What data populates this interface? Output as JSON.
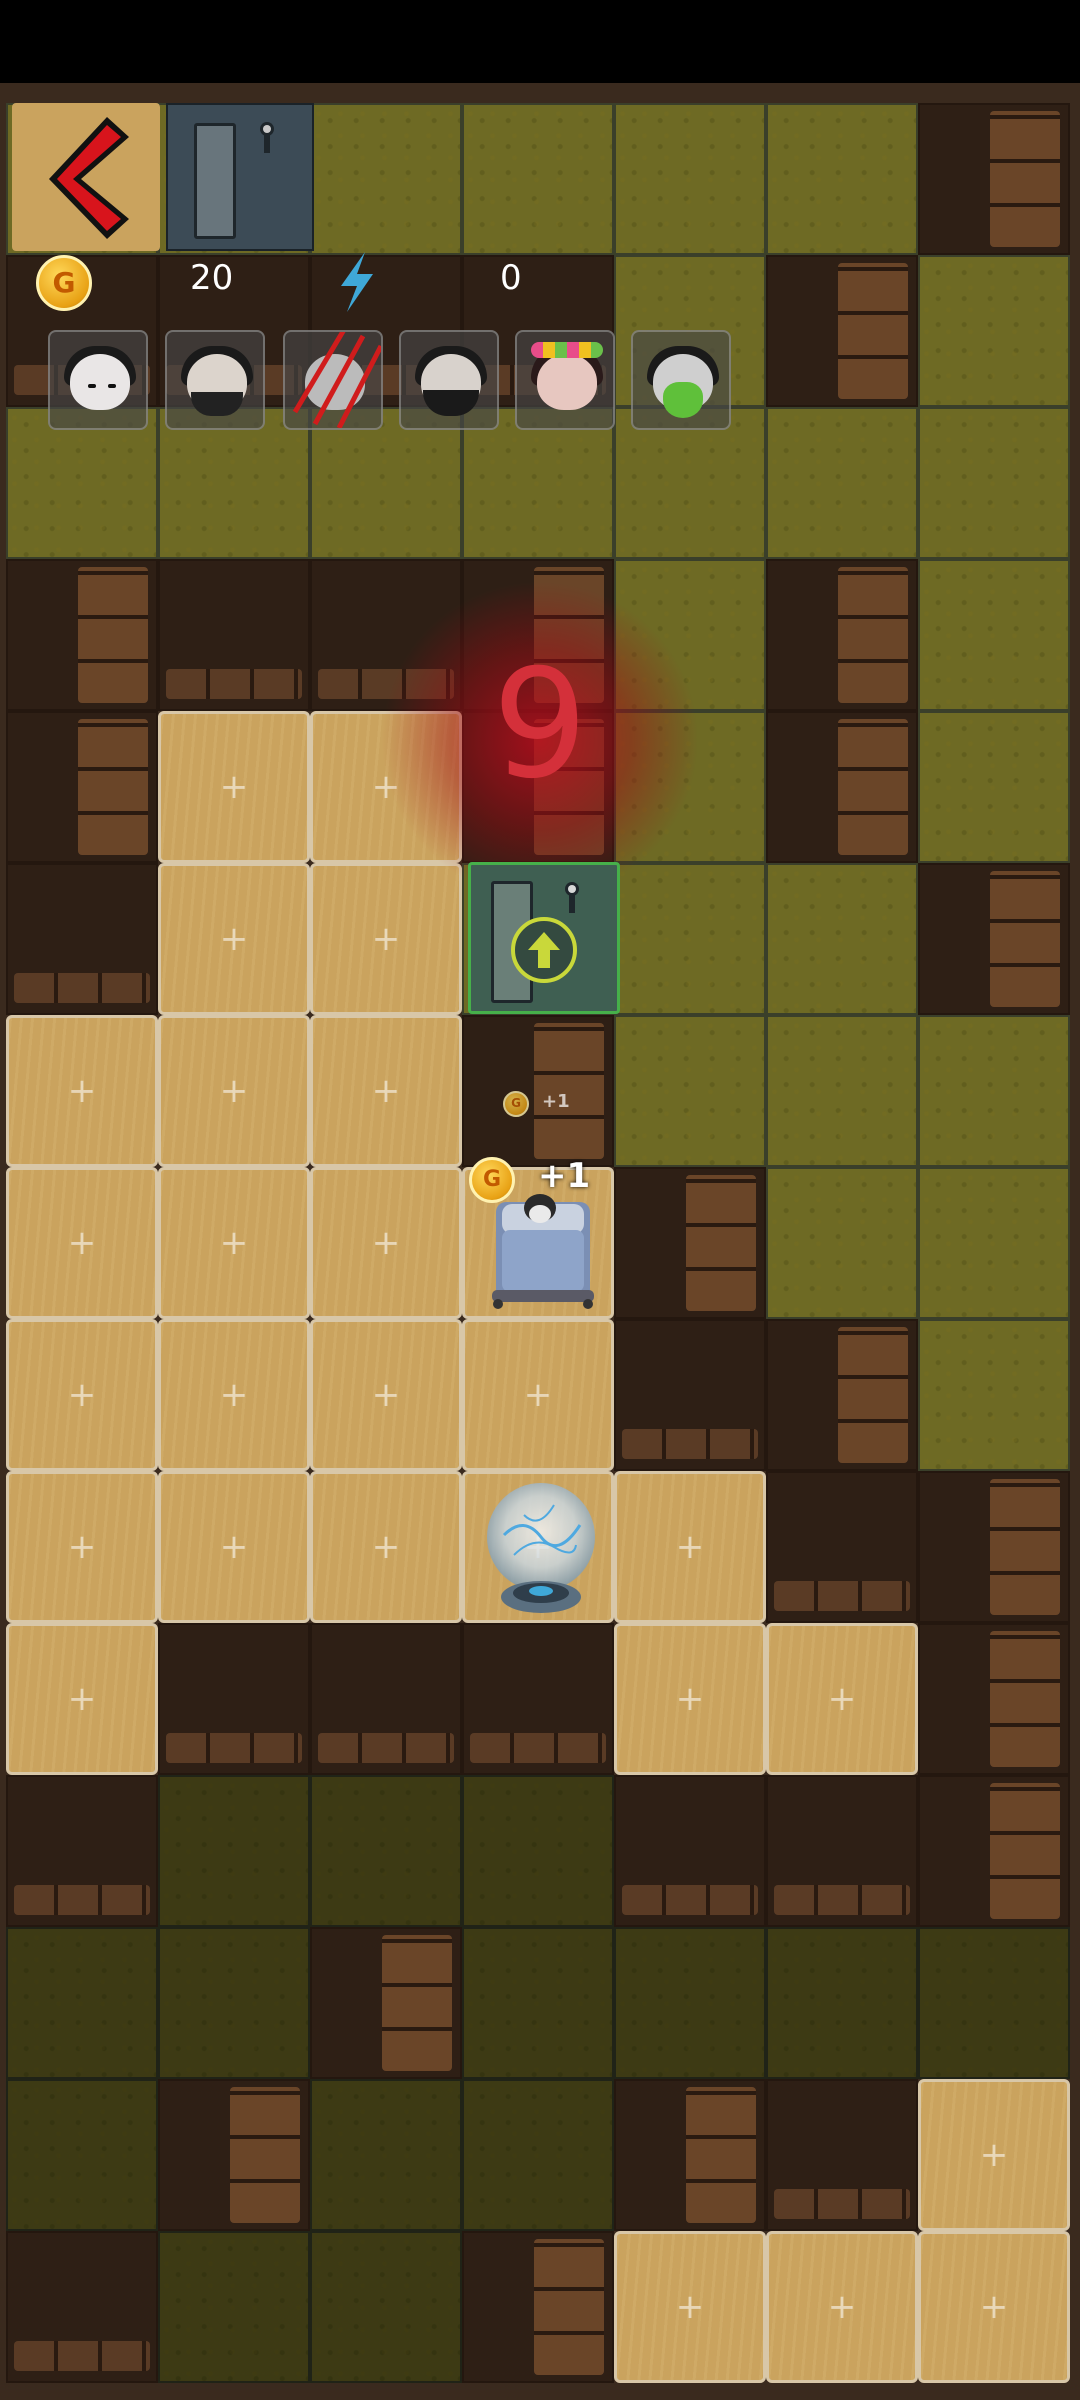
{
  "hud": {
    "back_icon": "back-chevron-icon",
    "door_icon": "door-icon",
    "coins": "20",
    "energy": "0",
    "coin_glyph": "G",
    "energy_icon": "lightning-icon"
  },
  "characters": [
    {
      "name": "character-pale-girl"
    },
    {
      "name": "character-masked-man"
    },
    {
      "name": "character-clawed"
    },
    {
      "name": "character-bearded-man"
    },
    {
      "name": "character-flower-girl"
    },
    {
      "name": "character-green-ghost"
    }
  ],
  "timer": {
    "value": "9"
  },
  "rewards": {
    "small": "+1",
    "bed": "+1"
  },
  "colors": {
    "grass": "#6e6a24",
    "floor": "#caa35e",
    "wall": "#2e1f15",
    "timer": "#d4303a",
    "exit_border": "#46b04a"
  },
  "board": {
    "rows": [
      [
        "grass",
        "door",
        "grass",
        "grass",
        "grass",
        "grass",
        "wall-v"
      ],
      [
        "wall",
        "wall",
        "wall",
        "wall",
        "grass",
        "wall-v",
        "grass"
      ],
      [
        "grass",
        "grass",
        "grass",
        "grass",
        "grass",
        "grass",
        "grass"
      ],
      [
        "wall-v",
        "wall",
        "wall",
        "wall-v",
        "grass",
        "wall-v",
        "grass"
      ],
      [
        "wall-v",
        "floor",
        "floor",
        "wall-v",
        "grass",
        "wall-v",
        "grass"
      ],
      [
        "wall",
        "floor",
        "floor",
        "exit",
        "grass",
        "grass",
        "wall-v"
      ],
      [
        "floor",
        "floor",
        "floor",
        "wall-v",
        "grass",
        "grass",
        "grass"
      ],
      [
        "floor",
        "floor",
        "floor",
        "floor",
        "wall-v",
        "grass",
        "grass"
      ],
      [
        "floor",
        "floor",
        "floor",
        "floor",
        "wall",
        "wall-v",
        "grass"
      ],
      [
        "floor",
        "floor",
        "floor",
        "floor",
        "floor",
        "wall",
        "wall-v"
      ],
      [
        "floor",
        "wall",
        "wall",
        "wall",
        "floor",
        "floor",
        "wall-v"
      ],
      [
        "wall",
        "grass",
        "grass",
        "grass",
        "wall",
        "wall",
        "wall-v"
      ],
      [
        "grass",
        "grass",
        "wall-v",
        "grass",
        "grass",
        "grass",
        "grass"
      ],
      [
        "grass",
        "wall-v",
        "grass",
        "grass",
        "wall-v",
        "wall",
        "floor"
      ],
      [
        "wall",
        "grass",
        "grass",
        "wall-v",
        "floor",
        "floor",
        "floor"
      ]
    ]
  }
}
